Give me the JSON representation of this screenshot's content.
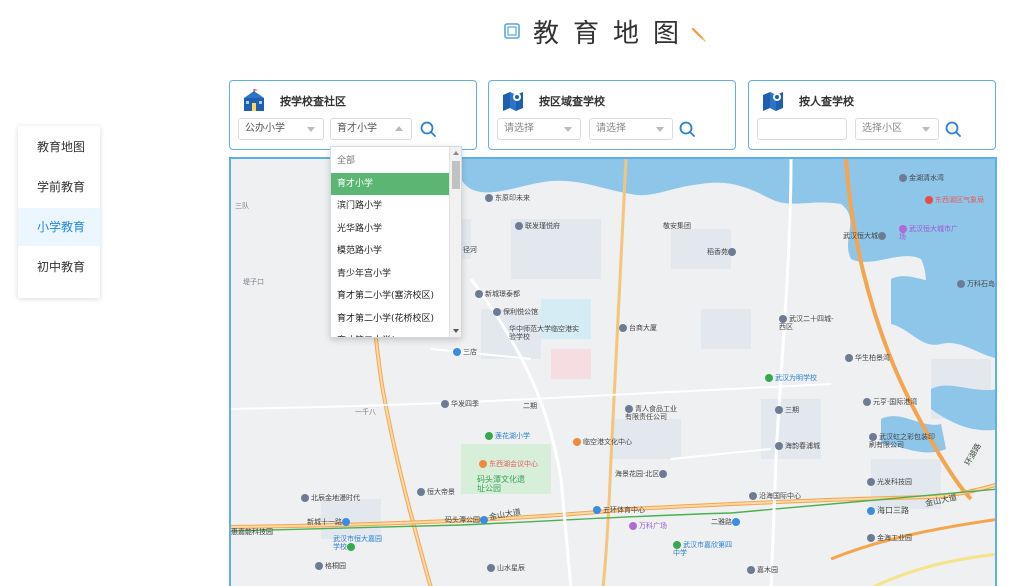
{
  "page": {
    "title": "教育地图"
  },
  "sidebar": {
    "items": [
      {
        "label": "教育地图",
        "active": false
      },
      {
        "label": "学前教育",
        "active": false
      },
      {
        "label": "小学教育",
        "active": true
      },
      {
        "label": "初中教育",
        "active": false
      }
    ]
  },
  "panels": {
    "school": {
      "label": "按学校查社区",
      "type_select": "公办小学",
      "school_select": "育才小学"
    },
    "area": {
      "label": "按区域查学校",
      "district_placeholder": "请选择",
      "street_placeholder": "请选择"
    },
    "person": {
      "label": "按人查学校",
      "input_value": "",
      "community_placeholder": "选择小区"
    }
  },
  "dropdown": {
    "options": [
      "全部",
      "育才小学",
      "滨门路小学",
      "光华路小学",
      "模范路小学",
      "青少年宫小学",
      "育才第二小学(塞济校区)",
      "育才第二小学(花桥校区)",
      "育才第二小学(..."
    ],
    "selected_index": 1
  },
  "map": {
    "labels": {
      "sanhui": "三队",
      "yuzikou": "堤子口",
      "dongfang": "东原印未来",
      "lianfa": "联发瑾悦府",
      "jingfa": "敬安集团",
      "jinghe": "径河",
      "baoxiang": "稻香苑",
      "jinhu": "金湖清水湾",
      "dongxihu_weather": "东西湖区气象局",
      "hengda": "武汉恒大城",
      "wanda": "武汉恒大城市广场",
      "wanke": "万科石岛",
      "xinchengli": "新城璟泰都",
      "baoli": "保利悦公馆",
      "huazhong": "华中师范大学临空港实验学校",
      "taishang": "台商大厦",
      "wuhan_23": "武汉二十四城-西区",
      "sanmen": "三店",
      "huasheng": "华生柏景湾",
      "yiqian": "一千八",
      "huafa": "华发四季",
      "erqi": "二期",
      "qingren": "青人食品工业有限责任公司",
      "wuhan_wei": "武汉为明学校",
      "sanqi": "三期",
      "yuanhe": "元亨·国际港湾",
      "lianhua": "莲花湖小学",
      "kongwan": "临空港文化中心",
      "dongxihu_hui": "东西湖会议中心",
      "haiyun": "海韵春浦城",
      "hongsheng": "武汉虹之彩包装印刷有限公司",
      "haijing": "海景花园·北区",
      "matou": "码头潭文化遗址公园",
      "guangfa": "光发科技园",
      "beichen": "北辰金地漫时代",
      "hengdadi": "恒大帝景",
      "wuhuan": "五环体育中心",
      "haikou": "海口三路",
      "jinsha": "金山大道",
      "erya": "二雅路",
      "gangfu": "沿海国际中心",
      "xinshiyi": "新城十一路",
      "matougongyuan": "码头潭公园",
      "wankeguang": "万科广场",
      "jinhai": "金海工业园",
      "wuhanjiaxin": "武汉市嘉欣第四中学",
      "huicui": "惠嘉能科技园",
      "zhuquan": "武汉市恒大嘉园学校",
      "gebu": "格桐园",
      "shanshui": "山水星辰",
      "yuyuan": "嘉木园",
      "jinshan2": "金山大道",
      "huanhu": "环湖路"
    }
  }
}
